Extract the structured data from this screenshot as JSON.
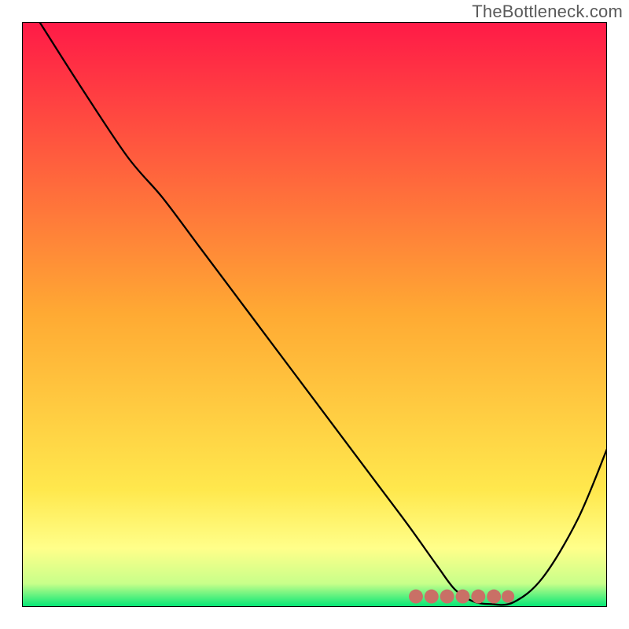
{
  "watermark": "TheBottleneck.com",
  "chart_data": {
    "type": "line",
    "title": "",
    "xlabel": "",
    "ylabel": "",
    "xlim": [
      0,
      100
    ],
    "ylim": [
      0,
      100
    ],
    "grid": false,
    "legend": false,
    "background_gradient": {
      "stops": [
        {
          "offset": 0.0,
          "color": "#ff1a47"
        },
        {
          "offset": 0.5,
          "color": "#ffaa33"
        },
        {
          "offset": 0.8,
          "color": "#ffe84d"
        },
        {
          "offset": 0.9,
          "color": "#ffff8a"
        },
        {
          "offset": 0.96,
          "color": "#c8ff8a"
        },
        {
          "offset": 1.0,
          "color": "#00e676"
        }
      ]
    },
    "series": [
      {
        "name": "bottleneck-curve",
        "color": "#000000",
        "width": 2.3,
        "x": [
          3,
          10,
          18,
          24,
          30,
          36,
          42,
          48,
          54,
          60,
          66,
          71,
          74,
          77,
          80,
          84,
          89,
          95,
          100
        ],
        "y": [
          100,
          89,
          77,
          70,
          62,
          54,
          46,
          38,
          30,
          22,
          14,
          7,
          3,
          1,
          0.5,
          0.8,
          5,
          15,
          27
        ]
      }
    ],
    "marker_band": {
      "name": "optimal-band",
      "color": "#c97066",
      "x_start": 66,
      "x_end": 82,
      "y": 1.8,
      "thickness": 2.4
    }
  }
}
